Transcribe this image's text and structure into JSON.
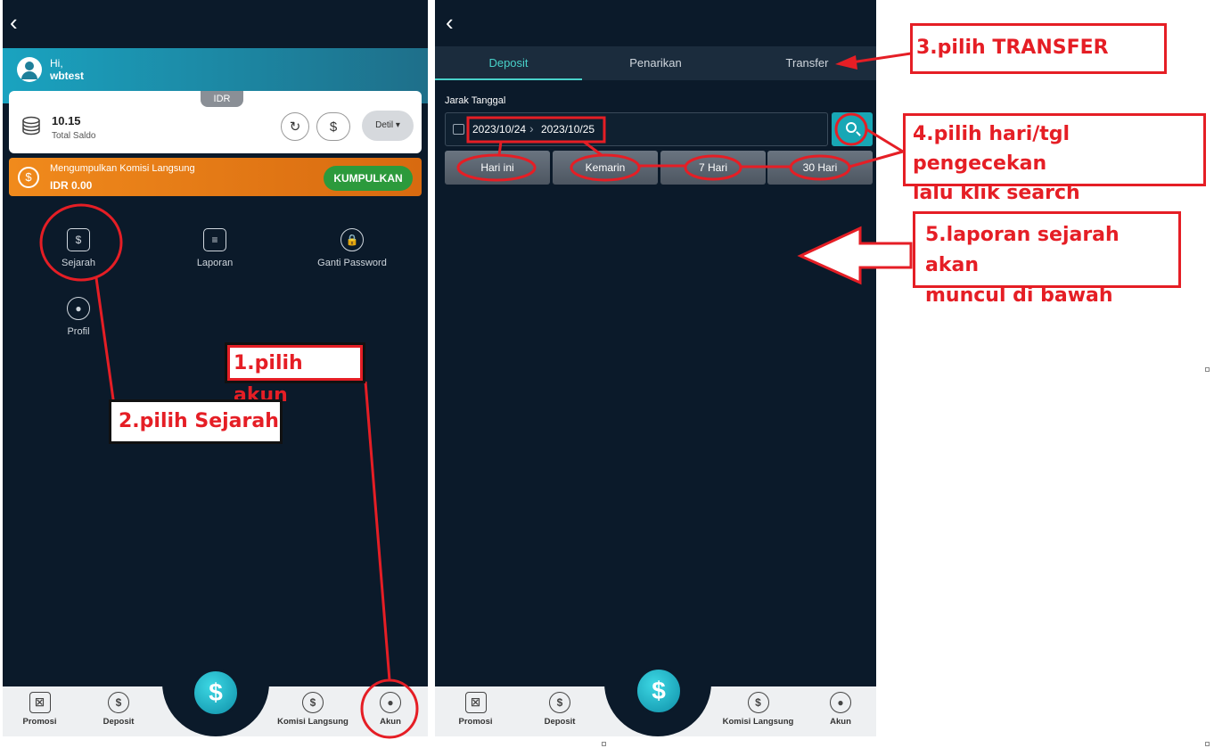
{
  "left_phone": {
    "greeting": "Hi,",
    "username": "wbtest",
    "currency_tab": "IDR",
    "balance_value": "10.15",
    "balance_label": "Total Saldo",
    "detil_label": "Detil ▾",
    "komisi_title": "Mengumpulkan Komisi Langsung",
    "komisi_value": "IDR 0.00",
    "kumpulkan_label": "KUMPULKAN",
    "menu": {
      "sejarah": "Sejarah",
      "laporan": "Laporan",
      "ganti_password": "Ganti Password",
      "profil": "Profil"
    }
  },
  "bottom_nav": {
    "promosi": "Promosi",
    "deposit": "Deposit",
    "dollar": "$",
    "komisi": "Komisi Langsung",
    "akun": "Akun"
  },
  "right_phone": {
    "tabs": [
      "Deposit",
      "Penarikan",
      "Transfer"
    ],
    "jarak_tanggal": "Jarak Tanggal",
    "date_from": "2023/10/24",
    "date_to": "2023/10/25",
    "quick_ranges": [
      "Hari ini",
      "Kemarin",
      "7 Hari",
      "30 Hari"
    ]
  },
  "annotations": {
    "step1": "1.pilih akun",
    "step2": "2.pilih Sejarah",
    "step3": "3.pilih TRANSFER",
    "step4_line1": "4.pilih hari/tgl pengecekan",
    "step4_line2": "lalu klik search",
    "step5_line1": "5.laporan sejarah akan",
    "step5_line2": "muncul di bawah"
  },
  "colors": {
    "phone_bg": "#0b1a2a",
    "accent_teal": "#48d1c9",
    "annotation_red": "#e51e25",
    "komisi_orange": "#f08a1c",
    "kumpulkan_green": "#2c9a3c"
  }
}
